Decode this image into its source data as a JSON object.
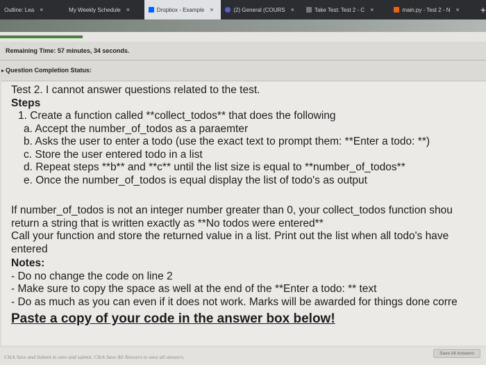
{
  "browser": {
    "tabs": [
      {
        "label": "Outline: Lea",
        "active": false
      },
      {
        "label": "My Weekly Schedule",
        "active": false
      },
      {
        "label": "Dropbox - Example",
        "active": true
      },
      {
        "label": "(2) General (COURS",
        "active": false
      },
      {
        "label": "Take Test: Test 2 - C",
        "active": false
      },
      {
        "label": "main.py - Test 2 - N",
        "active": false
      }
    ],
    "close_glyph": "×",
    "new_tab_glyph": "+",
    "accent_color": "#4a7f3d"
  },
  "test": {
    "remaining_time": "Remaining Time: 57 minutes, 34 seconds.",
    "completion_status_label": "Question Completion Status:",
    "progress_fraction": 0.17
  },
  "question": {
    "line1": "Test 2.  I cannot answer questions related to the test.",
    "steps_heading": "Steps",
    "step1": "1. Create a function called **collect_todos** that does the following",
    "step1a": "a. Accept the number_of_todos as a paraemter",
    "step1b": "b. Asks the user to enter a todo (use the exact text to prompt them: **Enter a todo: **)",
    "step1c": "c. Store the user entered todo in a list",
    "step1d": "d. Repeat steps **b** and **c** until the list size is equal to **number_of_todos**",
    "step1e": "e. Once the number_of_todos is equal display the list of todo's as output",
    "para1": "If number_of_todos is not an integer number greater than 0, your collect_todos function shou",
    "para2": "return a string that is written exactly as **No todos were entered**",
    "para3": "Call your function and store the returned value in a list. Print out the list when all todo's have",
    "para4": "entered",
    "notes_heading": "Notes:",
    "note1": "- Do no change the code on line 2",
    "note2": "- Make sure to copy the space as well at the end of the **Enter a todo: ** text",
    "note3": "- Do as much as you can even if it does not work. Marks will be awarded for things done corre",
    "paste": "Paste a copy of your code in the answer box below!"
  },
  "footer": {
    "hint": "Click Save and Submit to save and submit. Click Save All Answers to save all answers.",
    "save_all": "Save All Answers"
  }
}
